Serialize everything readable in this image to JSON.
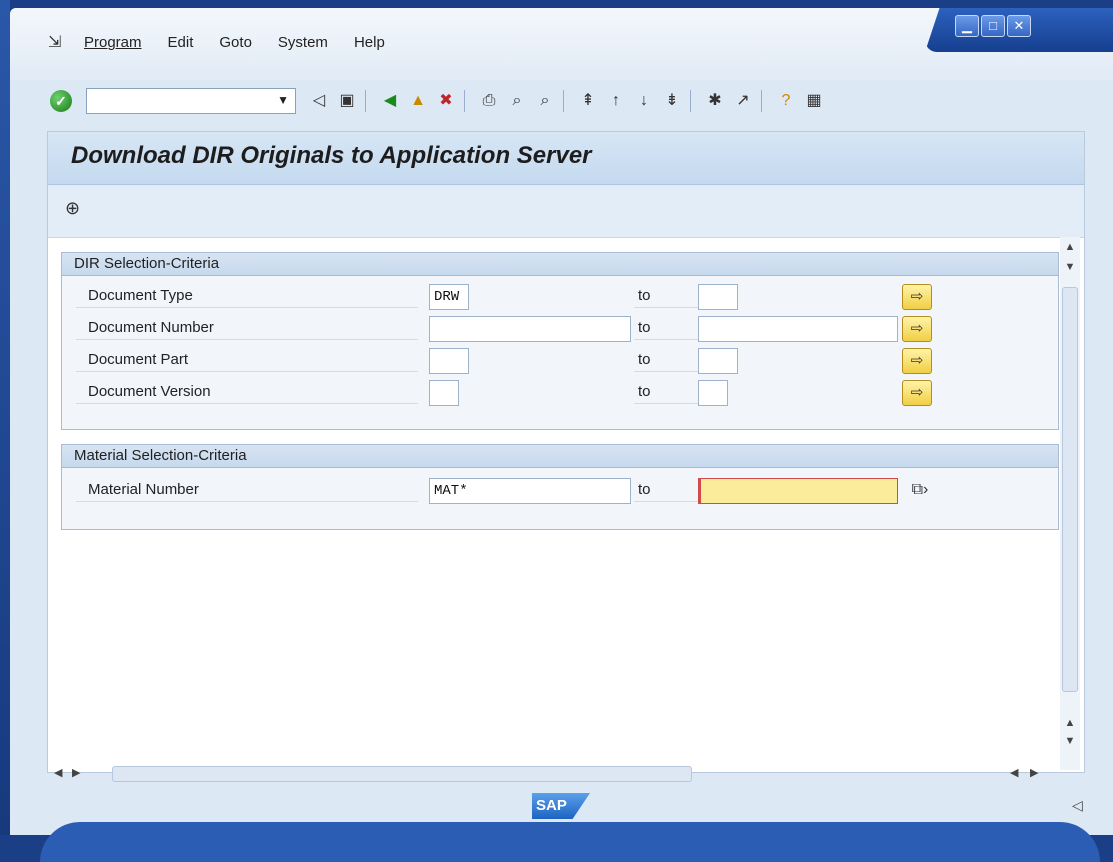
{
  "menu": {
    "items": [
      "Program",
      "Edit",
      "Goto",
      "System",
      "Help"
    ]
  },
  "toolbar": {
    "command_value": "",
    "icons": [
      "back-icon",
      "save-icon",
      "back-green-icon",
      "exit-icon",
      "cancel-icon",
      "print-icon",
      "find-icon",
      "find-next-icon",
      "first-page-icon",
      "previous-page-icon",
      "next-page-icon",
      "last-page-icon",
      "create-session-icon",
      "shortcut-icon",
      "help-icon",
      "customize-layout-icon"
    ]
  },
  "screen": {
    "title": "Download DIR Originals to Application Server"
  },
  "dir_frame": {
    "heading": "DIR Selection-Criteria",
    "rows": [
      {
        "label": "Document Type",
        "from": "DRW",
        "to_label": "to",
        "to": ""
      },
      {
        "label": "Document Number",
        "from": "",
        "to_label": "to",
        "to": ""
      },
      {
        "label": "Document Part",
        "from": "",
        "to_label": "to",
        "to": ""
      },
      {
        "label": "Document Version",
        "from": "",
        "to_label": "to",
        "to": ""
      }
    ]
  },
  "material_frame": {
    "heading": "Material Selection-Criteria",
    "rows": [
      {
        "label": "Material Number",
        "from": "MAT*",
        "to_label": "to",
        "to": ""
      }
    ]
  },
  "status": {
    "logo": "SAP"
  },
  "colors": {
    "title_band": "#c4d9ef",
    "active_field": "#fbec9c",
    "window_frame": "#1b3f86"
  }
}
